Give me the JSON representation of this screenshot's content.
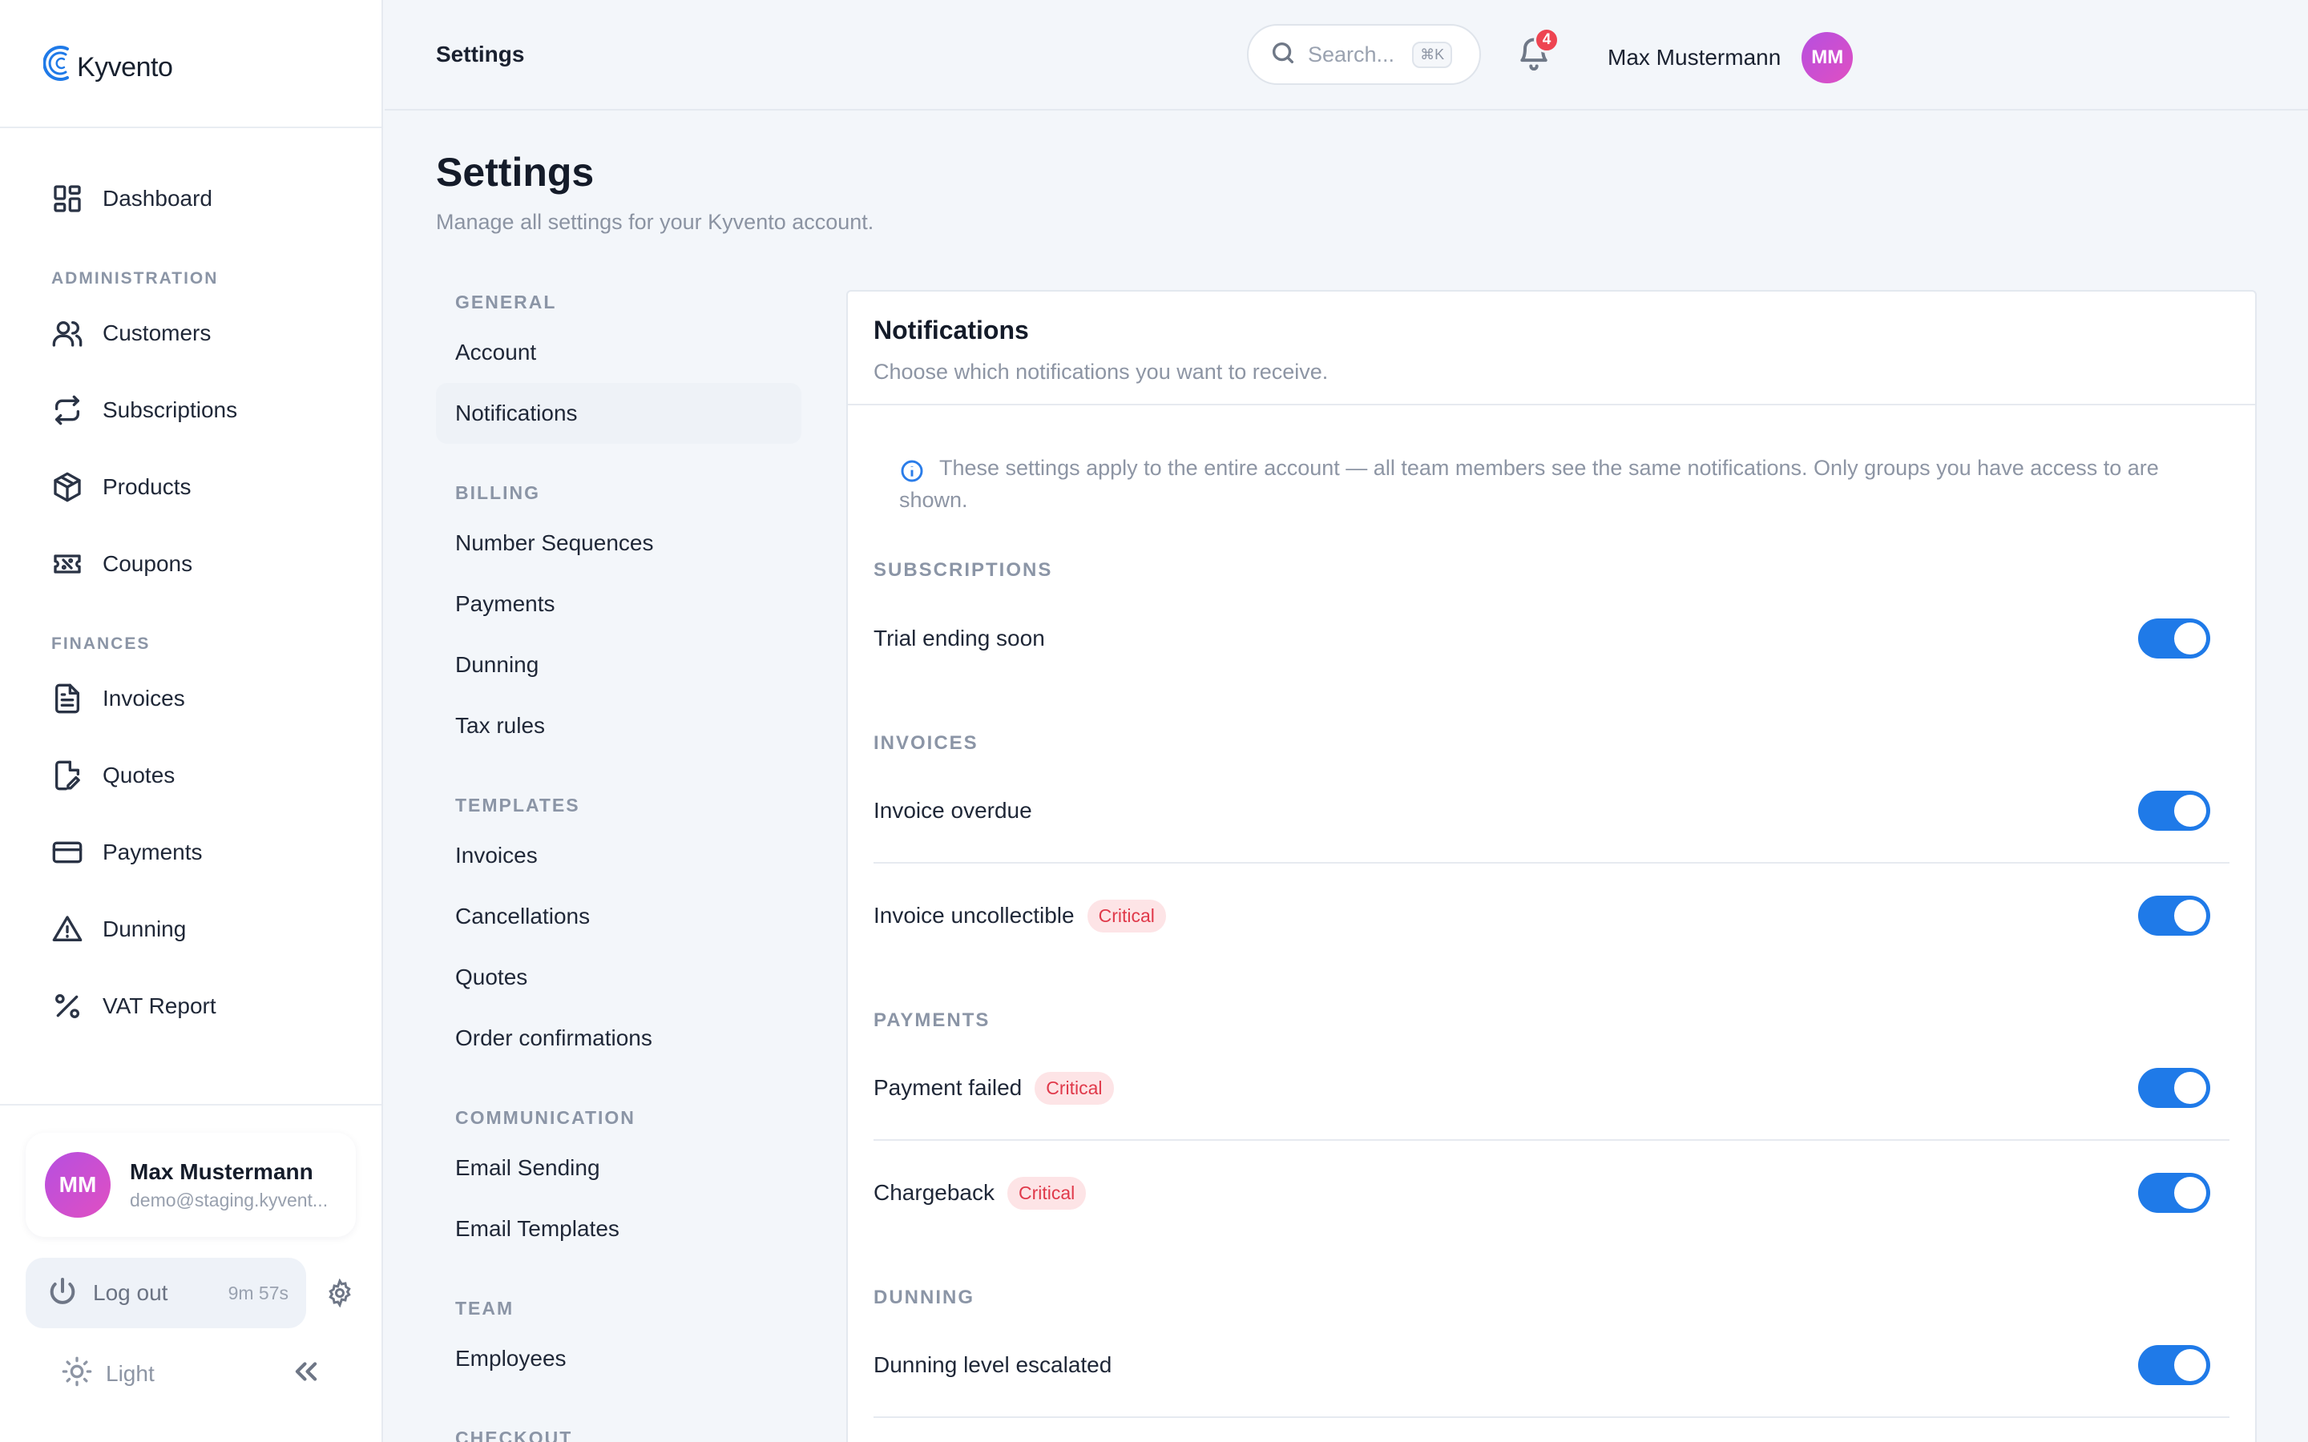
{
  "brand": {
    "name": "Kyvento"
  },
  "sidebar": {
    "top_items": [
      {
        "label": "Dashboard",
        "icon": "dashboard-icon"
      }
    ],
    "sections": [
      {
        "label": "ADMINISTRATION",
        "items": [
          {
            "label": "Customers",
            "icon": "users-icon"
          },
          {
            "label": "Subscriptions",
            "icon": "repeat-icon"
          },
          {
            "label": "Products",
            "icon": "box-icon"
          },
          {
            "label": "Coupons",
            "icon": "ticket-icon"
          }
        ]
      },
      {
        "label": "FINANCES",
        "items": [
          {
            "label": "Invoices",
            "icon": "file-text-icon"
          },
          {
            "label": "Quotes",
            "icon": "file-edit-icon"
          },
          {
            "label": "Payments",
            "icon": "credit-card-icon"
          },
          {
            "label": "Dunning",
            "icon": "alert-triangle-icon"
          },
          {
            "label": "VAT Report",
            "icon": "percent-icon"
          }
        ]
      }
    ],
    "user": {
      "initials": "MM",
      "name": "Max Mustermann",
      "email": "demo@staging.kyvent..."
    },
    "logout": {
      "label": "Log out",
      "timer": "9m 57s"
    },
    "theme": {
      "label": "Light"
    }
  },
  "header": {
    "title": "Settings",
    "search_placeholder": "Search...",
    "search_shortcut": "⌘K",
    "notification_count": "4",
    "user_name": "Max Mustermann",
    "user_initials": "MM"
  },
  "page": {
    "title": "Settings",
    "subtitle": "Manage all settings for your Kyvento account."
  },
  "settings_nav": [
    {
      "section": "GENERAL",
      "items": [
        "Account",
        "Notifications"
      ]
    },
    {
      "section": "BILLING",
      "items": [
        "Number Sequences",
        "Payments",
        "Dunning",
        "Tax rules"
      ]
    },
    {
      "section": "TEMPLATES",
      "items": [
        "Invoices",
        "Cancellations",
        "Quotes",
        "Order confirmations"
      ]
    },
    {
      "section": "COMMUNICATION",
      "items": [
        "Email Sending",
        "Email Templates"
      ]
    },
    {
      "section": "TEAM",
      "items": [
        "Employees"
      ]
    },
    {
      "section": "CHECKOUT",
      "items": []
    }
  ],
  "panel": {
    "title": "Notifications",
    "subtitle": "Choose which notifications you want to receive.",
    "info": "These settings apply to the entire account — all team members see the same notifications. Only groups you have access to are shown.",
    "groups": [
      {
        "label": "SUBSCRIPTIONS",
        "rows": [
          {
            "label": "Trial ending soon",
            "badge": "",
            "enabled": true
          }
        ]
      },
      {
        "label": "INVOICES",
        "rows": [
          {
            "label": "Invoice overdue",
            "badge": "",
            "enabled": true
          },
          {
            "label": "Invoice uncollectible",
            "badge": "Critical",
            "enabled": true
          }
        ]
      },
      {
        "label": "PAYMENTS",
        "rows": [
          {
            "label": "Payment failed",
            "badge": "Critical",
            "enabled": true
          },
          {
            "label": "Chargeback",
            "badge": "Critical",
            "enabled": true
          }
        ]
      },
      {
        "label": "DUNNING",
        "rows": [
          {
            "label": "Dunning level escalated",
            "badge": "",
            "enabled": true
          }
        ]
      }
    ]
  },
  "colors": {
    "accent": "#1f7ae8",
    "critical_bg": "#fde4e6",
    "critical_text": "#e0394a",
    "avatar": "#c94fd8"
  }
}
